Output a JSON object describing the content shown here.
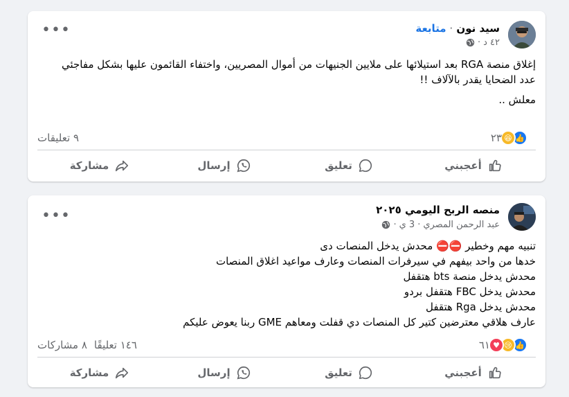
{
  "posts": [
    {
      "author": "سيد نون",
      "follow_label": "متابعة",
      "time": "٤٢ د",
      "body_lines": [
        "إغلاق منصة RGA بعد استيلائها على ملايين الجنيهات من أموال المصريين،  واختفاء القائمون عليها بشكل مفاجئي",
        " عدد الضحايا يقدر بالآلاف !!",
        "معلش .."
      ],
      "reactions_count": "٢٣",
      "comments_count": "٩ تعليقات",
      "shares_count": ""
    },
    {
      "author": "منصه الربح اليومي ٢٠٢٥",
      "sub_author": "عبد الرحمن المصري",
      "time": "3 ي",
      "body_lines": [
        "تنبيه مهم وخطير ⛔⛔ محدش يدخل المنصات دى",
        "خدها من واحد بيفهم في سيرفرات المنصات وعارف مواعيد اغلاق المنصات",
        "محدش يدخل منصة bts هتقفل",
        "محدش يدخل FBC  هتقفل بردو",
        "محدش يدخل Rga هتقفل",
        "عارف هلاقي معترضين كتير   كل المنصات دي قفلت   ومعاهم  GME  ربنا  يعوض عليكم"
      ],
      "reactions_count": "٦١",
      "comments_count": "١٤٦ تعليقًا",
      "shares_count": "٨ مشاركات"
    }
  ],
  "actions": {
    "like": "أعجبني",
    "comment": "تعليق",
    "send": "إرسال",
    "share": "مشاركة"
  },
  "more_label": "•••",
  "colors": {
    "accent": "#1b74e4",
    "secondary_text": "#65676b",
    "background": "#f0f2f5"
  },
  "icons": [
    "like-icon",
    "comment-icon",
    "whatsapp-send-icon",
    "share-icon",
    "globe-icon",
    "more-icon"
  ]
}
